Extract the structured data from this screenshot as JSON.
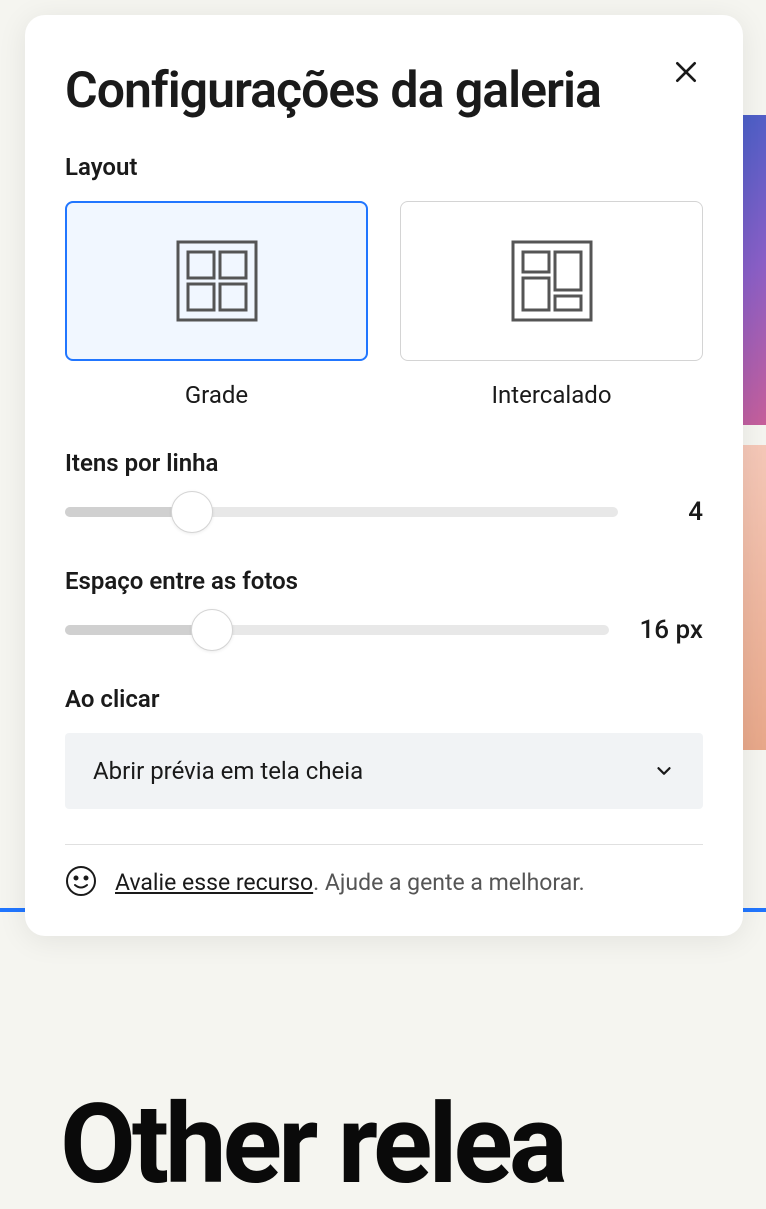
{
  "panel": {
    "title": "Configurações da galeria",
    "sections": {
      "layout": {
        "label": "Layout",
        "options": {
          "grid": "Grade",
          "collage": "Intercalado"
        }
      },
      "itemsPerRow": {
        "label": "Itens por linha",
        "value": "4",
        "sliderPercent": 23
      },
      "spacing": {
        "label": "Espaço entre as fotos",
        "value": "16 px",
        "sliderPercent": 27
      },
      "onClick": {
        "label": "Ao clicar",
        "selected": "Abrir prévia em tela cheia"
      }
    },
    "feedback": {
      "link": "Avalie esse recurso",
      "rest": ". Ajude a gente a melhorar."
    }
  },
  "background": {
    "text": "Other relea"
  }
}
